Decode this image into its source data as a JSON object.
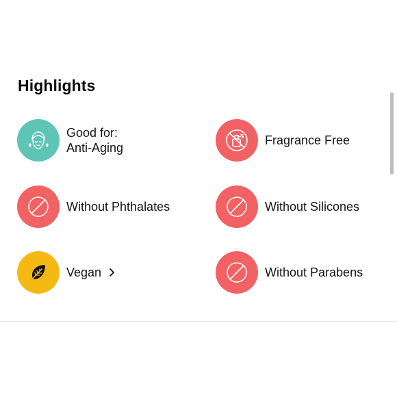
{
  "highlights": {
    "title": "Highlights",
    "colors": {
      "teal": "#5ec4b6",
      "coral": "#f26164",
      "yellow": "#f5b914"
    },
    "items": [
      {
        "icon": "face-icon",
        "line1": "Good for:",
        "line2": "Anti-Aging"
      },
      {
        "icon": "fragrance-free-icon",
        "label": "Fragrance Free"
      },
      {
        "icon": "prohibited-icon",
        "label": "Without Phthalates"
      },
      {
        "icon": "prohibited-icon",
        "label": "Without Silicones"
      },
      {
        "icon": "leaf-icon",
        "label": "Vegan"
      },
      {
        "icon": "prohibited-icon",
        "label": "Without Parabens"
      }
    ]
  }
}
